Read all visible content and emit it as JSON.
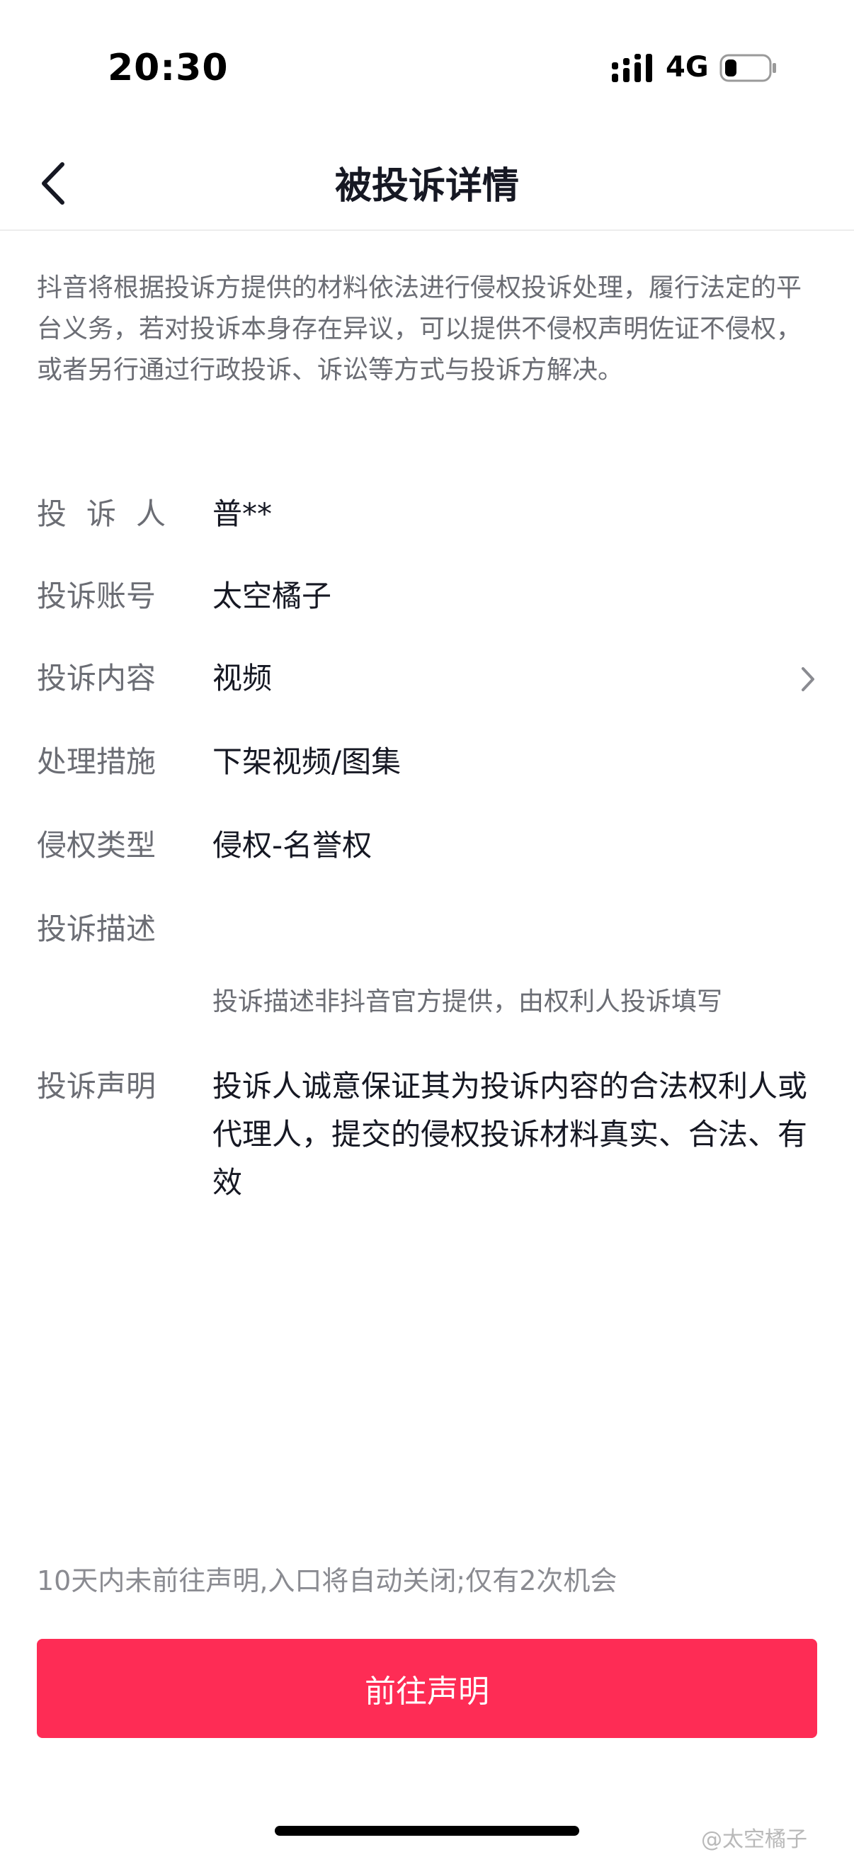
{
  "status_bar": {
    "time": "20:30",
    "network": "4G"
  },
  "nav": {
    "title": "被投诉详情"
  },
  "intro": "抖音将根据投诉方提供的材料依法进行侵权投诉处理，履行法定的平台义务，若对投诉本身存在异议，可以提供不侵权声明佐证不侵权，或者另行通过行政投诉、诉讼等方式与投诉方解决。",
  "details": {
    "complainant_label": "投诉人",
    "complainant_value": "普**",
    "account_label": "投诉账号",
    "account_value": "太空橘子",
    "content_label": "投诉内容",
    "content_value": "视频",
    "measure_label": "处理措施",
    "measure_value": "下架视频/图集",
    "type_label": "侵权类型",
    "type_value": "侵权-名誉权",
    "description_label": "投诉描述",
    "description_note": "投诉描述非抖音官方提供，由权利人投诉填写",
    "statement_label": "投诉声明",
    "statement_value": "投诉人诚意保证其为投诉内容的合法权利人或代理人，提交的侵权投诉材料真实、合法、有效"
  },
  "footer": {
    "note": "10天内未前往声明,入口将自动关闭;仅有2次机会",
    "button_label": "前往声明"
  },
  "watermark": "@太空橘子",
  "colors": {
    "primary": "#fe2c55",
    "label_gray": "#6b6d74",
    "text_dark": "#161823"
  }
}
